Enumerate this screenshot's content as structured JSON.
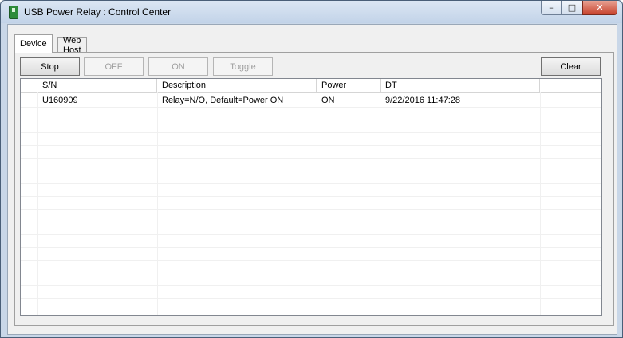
{
  "window": {
    "title": "USB Power Relay : Control Center",
    "minimize": "–",
    "maximize": "□",
    "close": "✕"
  },
  "tabs": [
    "Device",
    "Web Host"
  ],
  "toolbar": {
    "stop": "Stop",
    "off": "OFF",
    "on": "ON",
    "toggle": "Toggle",
    "clear": "Clear"
  },
  "table": {
    "columns": [
      "",
      "S/N",
      "Description",
      "Power",
      "DT",
      ""
    ],
    "rows": [
      {
        "index": "",
        "sn": "U160909",
        "description": "Relay=N/O, Default=Power ON",
        "power": "ON",
        "dt": "9/22/2016 11:47:28",
        "extra": ""
      }
    ]
  }
}
